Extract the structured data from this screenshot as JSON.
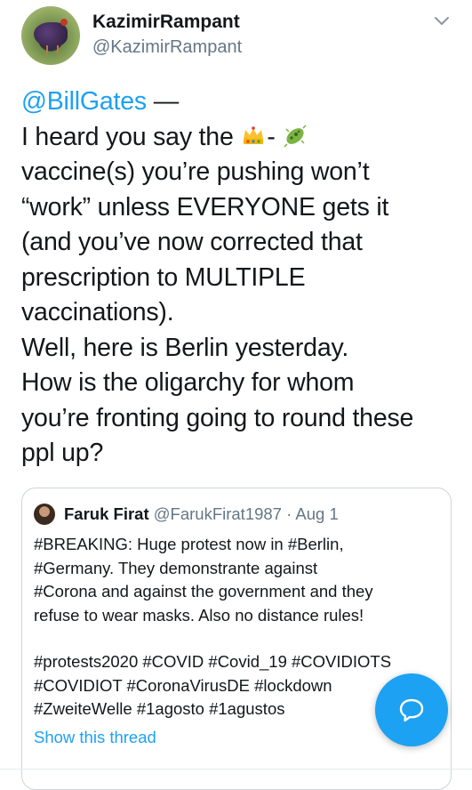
{
  "author": {
    "display_name": "KazimirRampant",
    "handle": "@KazimirRampant",
    "avatar_icon": "rooster-avatar-icon"
  },
  "tweet": {
    "mention": "@BillGates",
    "dash": " —",
    "lines": [
      "I heard you say the",
      "vaccine(s) you’re pushing won’t",
      "“work” unless EVERYONE gets it",
      "(and you’ve now corrected that",
      "prescription to MULTIPLE",
      "vaccinations).",
      "Well, here is Berlin yesterday.",
      "How is the oligarchy for whom",
      "you’re fronting going to round these",
      "ppl up?"
    ],
    "emoji_icons": [
      "crown-emoji-icon",
      "microbe-emoji-icon"
    ],
    "emoji_separator": "-"
  },
  "quoted_tweet": {
    "name": "Faruk Firat",
    "handle": "@FarukFirat1987",
    "separator": " · ",
    "date": "Aug 1",
    "lines": [
      "#BREAKING: Huge protest now in #Berlin,",
      "#Germany. They demonstrante against",
      "#Corona and against the government and they",
      "refuse to wear masks. Also no distance rules!"
    ],
    "hashtag_lines": [
      "#protests2020 #COVID #Covid_19 #COVIDIOTS",
      "#COVIDIOT #CoronaVirusDE #lockdown",
      "#ZweiteWelle #1agosto #1agustos"
    ],
    "show_thread": "Show this thread"
  },
  "colors": {
    "accent": "#1da1f2",
    "text": "#14171a",
    "secondary": "#657786",
    "border": "#ccd6dd"
  }
}
